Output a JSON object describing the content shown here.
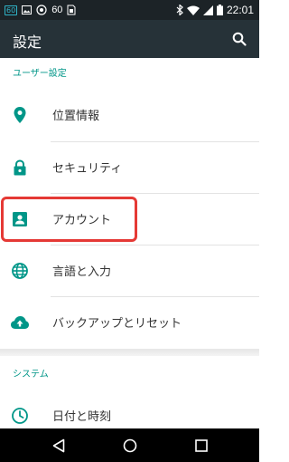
{
  "status_bar": {
    "left_badge": "60",
    "left_number": "60",
    "time": "22:01",
    "icons": [
      "network-badge-icon",
      "image-icon",
      "app-icon",
      "sim-icon",
      "bluetooth-icon",
      "wifi-icon",
      "signal-icon",
      "battery-icon"
    ]
  },
  "app_bar": {
    "title": "設定",
    "search_icon": "search-icon"
  },
  "sections": [
    {
      "header": "ユーザー設定",
      "items": [
        {
          "label": "位置情報",
          "icon": "location-icon"
        },
        {
          "label": "セキュリティ",
          "icon": "lock-icon"
        },
        {
          "label": "アカウント",
          "icon": "account-icon"
        },
        {
          "label": "言語と入力",
          "icon": "globe-icon"
        },
        {
          "label": "バックアップとリセット",
          "icon": "cloud-upload-icon"
        }
      ]
    },
    {
      "header": "システム",
      "items": [
        {
          "label": "日付と時刻",
          "icon": "clock-icon"
        }
      ]
    }
  ],
  "nav_bar": {
    "icons": [
      "back-icon",
      "home-icon",
      "recents-icon"
    ]
  },
  "colors": {
    "accent": "#009688",
    "app_bar": "#263238",
    "status_bar": "#1c2327",
    "highlight": "#e53935"
  }
}
